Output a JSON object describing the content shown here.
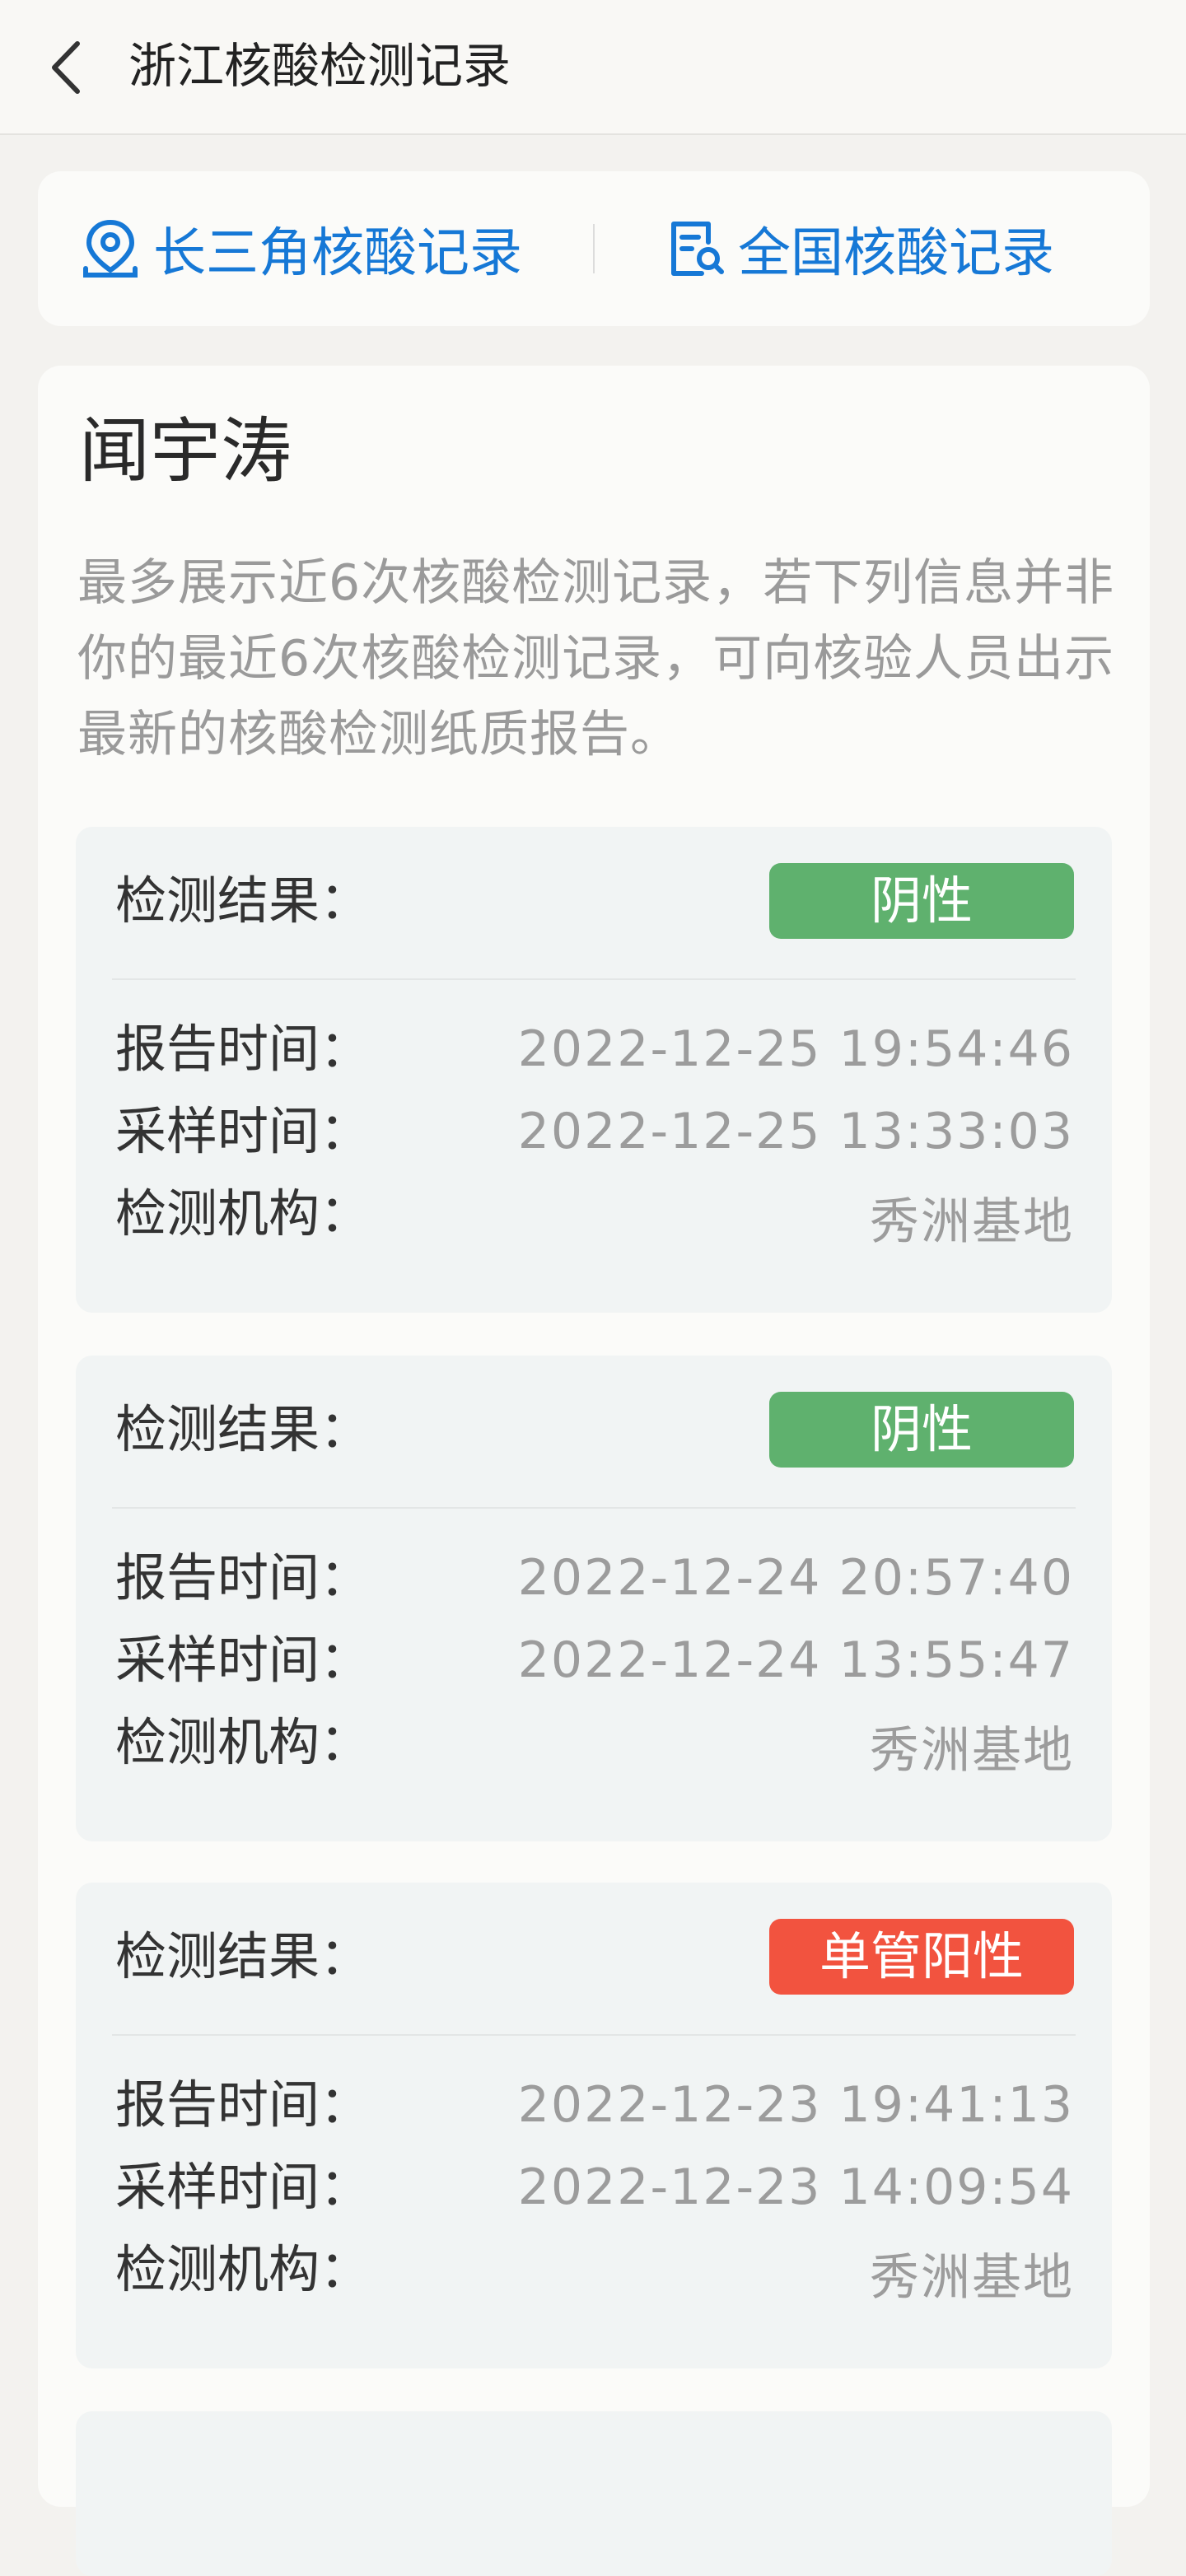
{
  "header": {
    "title": "浙江核酸检测记录"
  },
  "tabs": [
    {
      "label": "长三角核酸记录",
      "icon": "location-pin-icon"
    },
    {
      "label": "全国核酸记录",
      "icon": "document-search-icon"
    }
  ],
  "user": {
    "name": "闻宇涛"
  },
  "notice": "最多展示近6次核酸检测记录，若下列信息并非你的最近6次核酸检测记录，可向核验人员出示最新的核酸检测纸质报告。",
  "labels": {
    "result": "检测结果：",
    "report_time": "报告时间：",
    "sample_time": "采样时间：",
    "institution": "检测机构："
  },
  "records": [
    {
      "result": "阴性",
      "result_color": "#5fb16e",
      "report_time": "2022-12-25 19:54:46",
      "sample_time": "2022-12-25 13:33:03",
      "institution": "秀洲基地"
    },
    {
      "result": "阴性",
      "result_color": "#5fb16e",
      "report_time": "2022-12-24 20:57:40",
      "sample_time": "2022-12-24 13:55:47",
      "institution": "秀洲基地"
    },
    {
      "result": "单管阳性",
      "result_color": "#f2533f",
      "report_time": "2022-12-23 19:41:13",
      "sample_time": "2022-12-23 14:09:54",
      "institution": "秀洲基地"
    }
  ],
  "colors": {
    "accent": "#1678d6",
    "negative": "#5fb16e",
    "positive": "#f2533f"
  }
}
